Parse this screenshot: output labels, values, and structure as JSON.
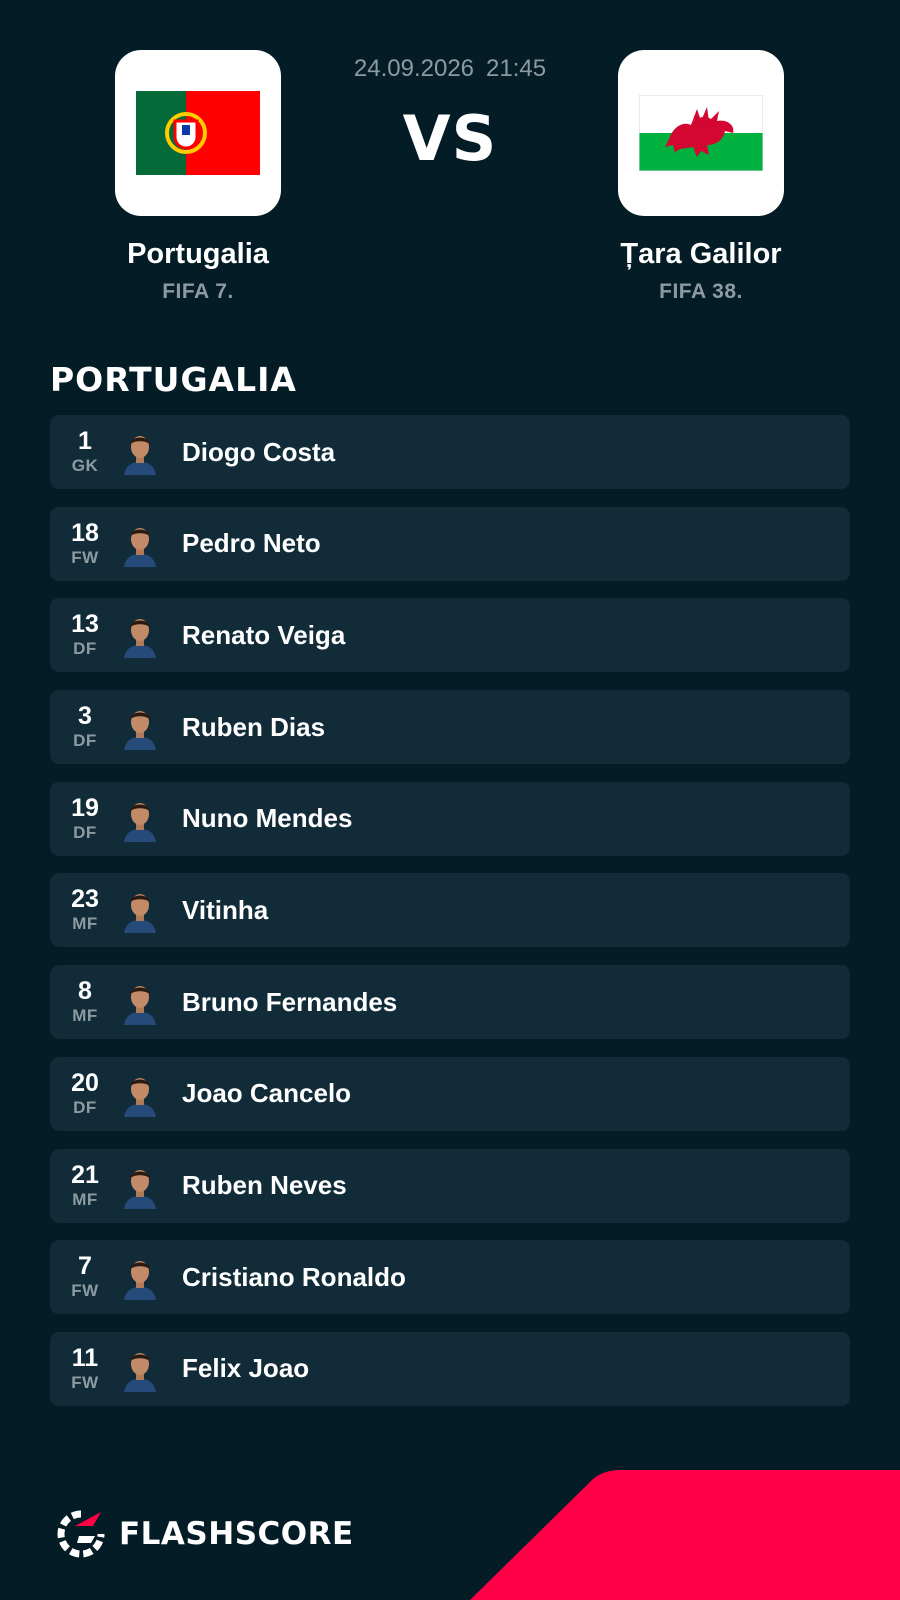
{
  "match": {
    "date": "24.09.2026",
    "time": "21:45",
    "vs_label": "VS"
  },
  "home_team": {
    "name": "Portugalia",
    "rank": "FIFA 7.",
    "flag_icon": "portugal-flag-icon",
    "flag_colors": {
      "green": "#046a38",
      "red": "#ff0000",
      "emblem": "#ffcc00"
    }
  },
  "away_team": {
    "name": "Țara Galilor",
    "rank": "FIFA 38.",
    "flag_icon": "wales-flag-icon",
    "flag_colors": {
      "white": "#ffffff",
      "green": "#00b140",
      "dragon": "#d30731"
    }
  },
  "lineup": {
    "title": "PORTUGALIA",
    "players": [
      {
        "number": "1",
        "position": "GK",
        "name": "Diogo Costa",
        "avatar_icon": "player-photo-icon"
      },
      {
        "number": "18",
        "position": "FW",
        "name": "Pedro Neto",
        "avatar_icon": "player-photo-icon"
      },
      {
        "number": "13",
        "position": "DF",
        "name": "Renato Veiga",
        "avatar_icon": "player-photo-icon"
      },
      {
        "number": "3",
        "position": "DF",
        "name": "Ruben Dias",
        "avatar_icon": "player-photo-icon"
      },
      {
        "number": "19",
        "position": "DF",
        "name": "Nuno Mendes",
        "avatar_icon": "player-photo-icon"
      },
      {
        "number": "23",
        "position": "MF",
        "name": "Vitinha",
        "avatar_icon": "player-photo-icon"
      },
      {
        "number": "8",
        "position": "MF",
        "name": "Bruno Fernandes",
        "avatar_icon": "player-photo-icon"
      },
      {
        "number": "20",
        "position": "DF",
        "name": "Joao Cancelo",
        "avatar_icon": "player-photo-icon"
      },
      {
        "number": "21",
        "position": "MF",
        "name": "Ruben Neves",
        "avatar_icon": "player-photo-icon"
      },
      {
        "number": "7",
        "position": "FW",
        "name": "Cristiano Ronaldo",
        "avatar_icon": "player-photo-icon"
      },
      {
        "number": "11",
        "position": "FW",
        "name": "Felix Joao",
        "avatar_icon": "player-photo-icon"
      }
    ]
  },
  "brand": {
    "name": "FLASHSCORE",
    "logo_icon": "flashscore-logo-icon",
    "accent_color": "#ff0046"
  },
  "colors": {
    "background": "#031c26",
    "row_background": "#112c38",
    "muted_text": "#8d9aa2"
  }
}
